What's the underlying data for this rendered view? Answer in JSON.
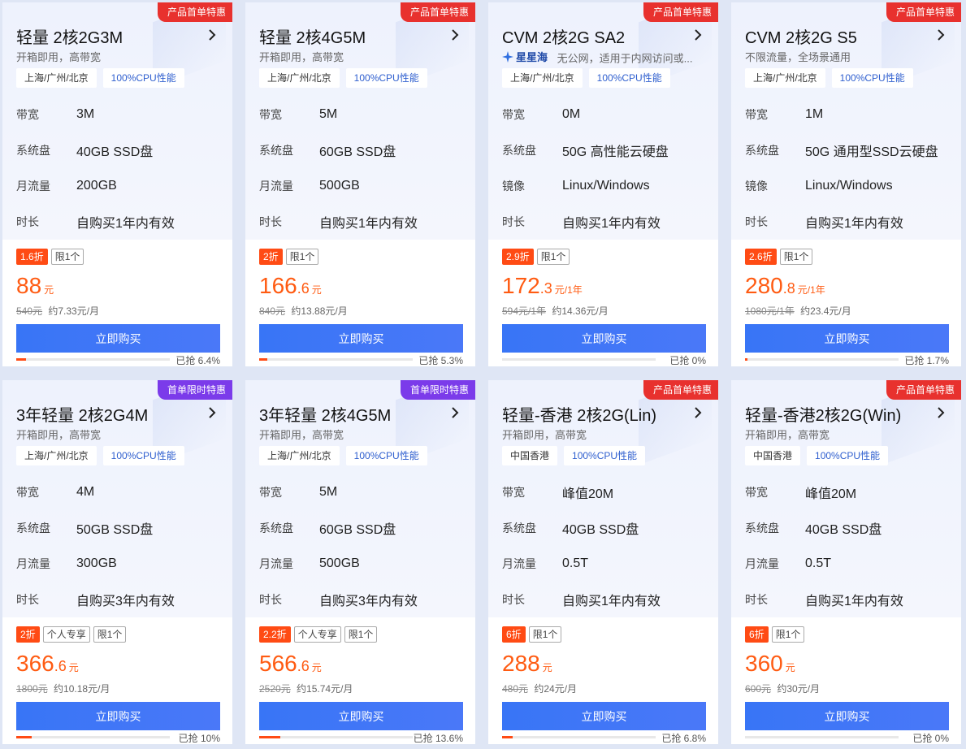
{
  "cards": [
    {
      "badge": "产品首单特惠",
      "badge_color": "#e8312e",
      "title": "轻量 2核2G3M",
      "brand": "",
      "subtitle": "开箱即用，高带宽",
      "location": "上海/广州/北京",
      "cpu": "100%CPU性能",
      "specs": [
        {
          "k": "带宽",
          "v": "3M"
        },
        {
          "k": "系统盘",
          "v": "40GB SSD盘"
        },
        {
          "k": "月流量",
          "v": "200GB"
        },
        {
          "k": "时长",
          "v": "自购买1年内有效"
        }
      ],
      "discount": "1.6折",
      "extra_tag": "",
      "limit": "限1个",
      "price_int": "88",
      "price_dec": "",
      "price_unit": "元",
      "orig_price": "540元",
      "per_month": "约7.33元/月",
      "buy_label": "立即购买",
      "sold_label": "已抢 6.4%",
      "sold_pct": 6.4
    },
    {
      "badge": "产品首单特惠",
      "badge_color": "#e8312e",
      "title": "轻量 2核4G5M",
      "brand": "",
      "subtitle": "开箱即用，高带宽",
      "location": "上海/广州/北京",
      "cpu": "100%CPU性能",
      "specs": [
        {
          "k": "带宽",
          "v": "5M"
        },
        {
          "k": "系统盘",
          "v": "60GB SSD盘"
        },
        {
          "k": "月流量",
          "v": "500GB"
        },
        {
          "k": "时长",
          "v": "自购买1年内有效"
        }
      ],
      "discount": "2折",
      "extra_tag": "",
      "limit": "限1个",
      "price_int": "166",
      "price_dec": ".6",
      "price_unit": "元",
      "orig_price": "840元",
      "per_month": "约13.88元/月",
      "buy_label": "立即购买",
      "sold_label": "已抢 5.3%",
      "sold_pct": 5.3
    },
    {
      "badge": "产品首单特惠",
      "badge_color": "#e8312e",
      "title": "CVM 2核2G SA2",
      "brand": "星星海",
      "subtitle": "无公网，适用于内网访问或...",
      "location": "上海/广州/北京",
      "cpu": "100%CPU性能",
      "specs": [
        {
          "k": "带宽",
          "v": "0M"
        },
        {
          "k": "系统盘",
          "v": "50G 高性能云硬盘"
        },
        {
          "k": "镜像",
          "v": "Linux/Windows"
        },
        {
          "k": "时长",
          "v": "自购买1年内有效"
        }
      ],
      "discount": "2.9折",
      "extra_tag": "",
      "limit": "限1个",
      "price_int": "172",
      "price_dec": ".3",
      "price_unit": "元/1年",
      "orig_price": "594元/1年",
      "per_month": "约14.36元/月",
      "buy_label": "立即购买",
      "sold_label": "已抢 0%",
      "sold_pct": 0
    },
    {
      "badge": "产品首单特惠",
      "badge_color": "#e8312e",
      "title": "CVM 2核2G S5",
      "brand": "",
      "subtitle": "不限流量，全场景通用",
      "location": "上海/广州/北京",
      "cpu": "100%CPU性能",
      "specs": [
        {
          "k": "带宽",
          "v": "1M"
        },
        {
          "k": "系统盘",
          "v": "50G 通用型SSD云硬盘"
        },
        {
          "k": "镜像",
          "v": "Linux/Windows"
        },
        {
          "k": "时长",
          "v": "自购买1年内有效"
        }
      ],
      "discount": "2.6折",
      "extra_tag": "",
      "limit": "限1个",
      "price_int": "280",
      "price_dec": ".8",
      "price_unit": "元/1年",
      "orig_price": "1080元/1年",
      "per_month": "约23.4元/月",
      "buy_label": "立即购买",
      "sold_label": "已抢 1.7%",
      "sold_pct": 1.7
    },
    {
      "badge": "首单限时特惠",
      "badge_color": "#7b3bea",
      "title": "3年轻量 2核2G4M",
      "brand": "",
      "subtitle": "开箱即用，高带宽",
      "location": "上海/广州/北京",
      "cpu": "100%CPU性能",
      "specs": [
        {
          "k": "带宽",
          "v": "4M"
        },
        {
          "k": "系统盘",
          "v": "50GB SSD盘"
        },
        {
          "k": "月流量",
          "v": "300GB"
        },
        {
          "k": "时长",
          "v": "自购买3年内有效"
        }
      ],
      "discount": "2折",
      "extra_tag": "个人专享",
      "limit": "限1个",
      "price_int": "366",
      "price_dec": ".6",
      "price_unit": "元",
      "orig_price": "1800元",
      "per_month": "约10.18元/月",
      "buy_label": "立即购买",
      "sold_label": "已抢 10%",
      "sold_pct": 10
    },
    {
      "badge": "首单限时特惠",
      "badge_color": "#7b3bea",
      "title": "3年轻量 2核4G5M",
      "brand": "",
      "subtitle": "开箱即用，高带宽",
      "location": "上海/广州/北京",
      "cpu": "100%CPU性能",
      "specs": [
        {
          "k": "带宽",
          "v": "5M"
        },
        {
          "k": "系统盘",
          "v": "60GB SSD盘"
        },
        {
          "k": "月流量",
          "v": "500GB"
        },
        {
          "k": "时长",
          "v": "自购买3年内有效"
        }
      ],
      "discount": "2.2折",
      "extra_tag": "个人专享",
      "limit": "限1个",
      "price_int": "566",
      "price_dec": ".6",
      "price_unit": "元",
      "orig_price": "2520元",
      "per_month": "约15.74元/月",
      "buy_label": "立即购买",
      "sold_label": "已抢 13.6%",
      "sold_pct": 13.6
    },
    {
      "badge": "产品首单特惠",
      "badge_color": "#e8312e",
      "title": "轻量-香港 2核2G(Lin)",
      "brand": "",
      "subtitle": "开箱即用，高带宽",
      "location": "中国香港",
      "cpu": "100%CPU性能",
      "specs": [
        {
          "k": "带宽",
          "v": "峰值20M"
        },
        {
          "k": "系统盘",
          "v": "40GB SSD盘"
        },
        {
          "k": "月流量",
          "v": "0.5T"
        },
        {
          "k": "时长",
          "v": "自购买1年内有效"
        }
      ],
      "discount": "6折",
      "extra_tag": "",
      "limit": "限1个",
      "price_int": "288",
      "price_dec": "",
      "price_unit": "元",
      "orig_price": "480元",
      "per_month": "约24元/月",
      "buy_label": "立即购买",
      "sold_label": "已抢 6.8%",
      "sold_pct": 6.8
    },
    {
      "badge": "产品首单特惠",
      "badge_color": "#e8312e",
      "title": "轻量-香港2核2G(Win)",
      "brand": "",
      "subtitle": "开箱即用，高带宽",
      "location": "中国香港",
      "cpu": "100%CPU性能",
      "specs": [
        {
          "k": "带宽",
          "v": "峰值20M"
        },
        {
          "k": "系统盘",
          "v": "40GB SSD盘"
        },
        {
          "k": "月流量",
          "v": "0.5T"
        },
        {
          "k": "时长",
          "v": "自购买1年内有效"
        }
      ],
      "discount": "6折",
      "extra_tag": "",
      "limit": "限1个",
      "price_int": "360",
      "price_dec": "",
      "price_unit": "元",
      "orig_price": "600元",
      "per_month": "约30元/月",
      "buy_label": "立即购买",
      "sold_label": "已抢 0%",
      "sold_pct": 0
    }
  ]
}
